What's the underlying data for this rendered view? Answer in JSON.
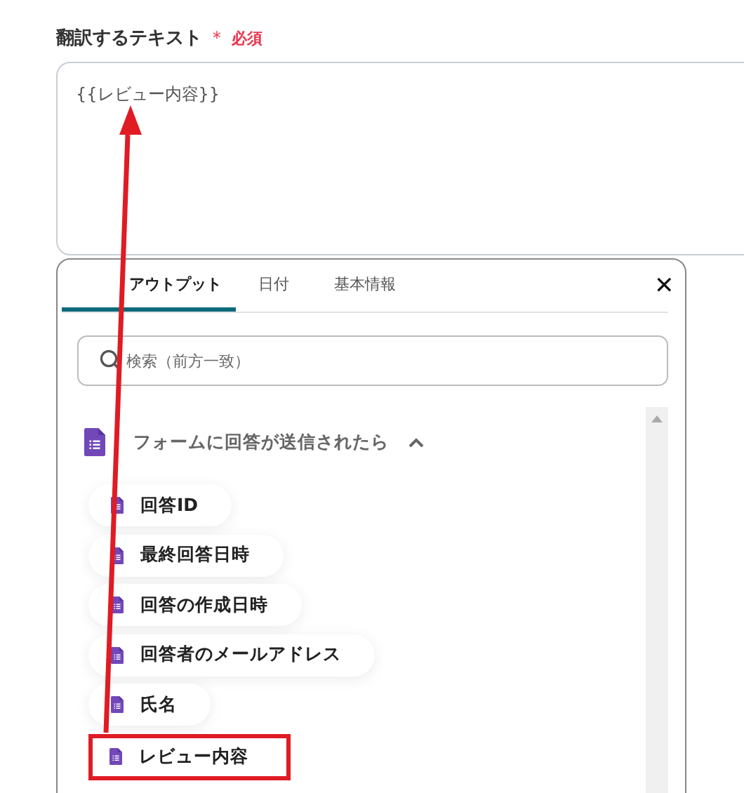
{
  "field": {
    "label": "翻訳するテキスト",
    "required_mark": "＊",
    "required_text": "必須",
    "value": "{{レビュー内容}}"
  },
  "popup": {
    "tabs": [
      {
        "label": "アウトプット",
        "selected": true
      },
      {
        "label": "日付",
        "selected": false
      },
      {
        "label": "基本情報",
        "selected": false
      }
    ],
    "close": "✕",
    "search": {
      "placeholder": "検索（前方一致）"
    },
    "section": {
      "title": "フォームに回答が送信されたら",
      "expanded": true
    },
    "items": [
      {
        "label": "回答ID",
        "highlighted": false
      },
      {
        "label": "最終回答日時",
        "highlighted": false
      },
      {
        "label": "回答の作成日時",
        "highlighted": false
      },
      {
        "label": "回答者のメールアドレス",
        "highlighted": false
      },
      {
        "label": "氏名",
        "highlighted": false
      },
      {
        "label": "レビュー内容",
        "highlighted": true
      }
    ]
  }
}
